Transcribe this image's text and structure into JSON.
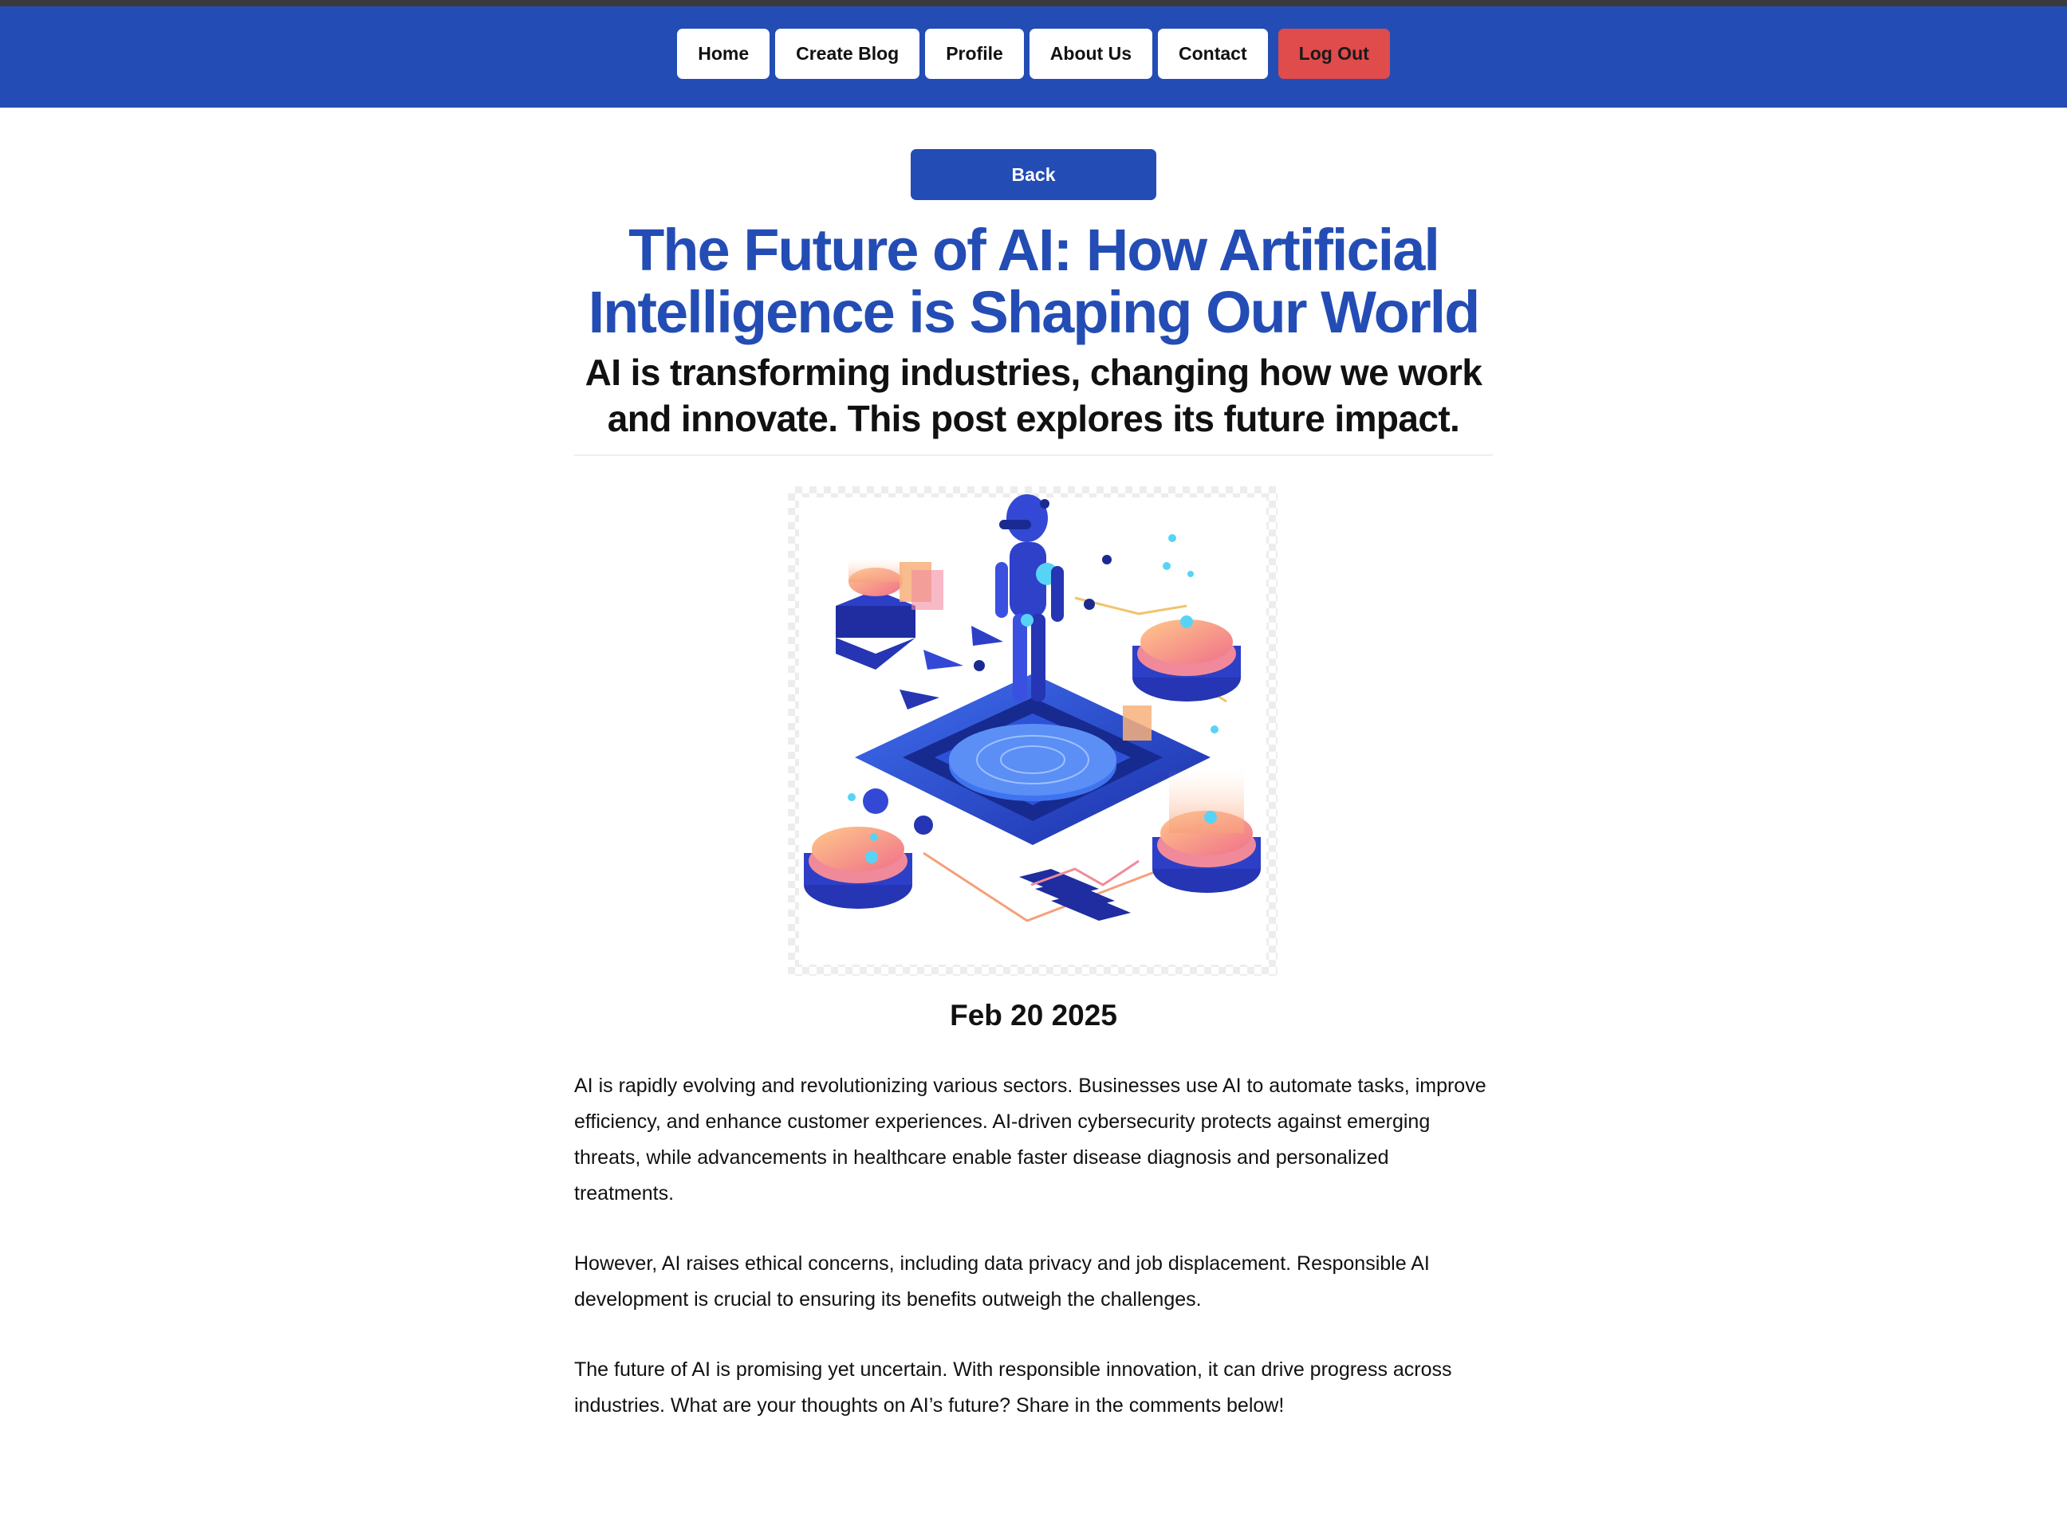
{
  "nav": {
    "items": [
      {
        "label": "Home",
        "name": "nav-home-button"
      },
      {
        "label": "Create Blog",
        "name": "nav-create-blog-button"
      },
      {
        "label": "Profile",
        "name": "nav-profile-button"
      },
      {
        "label": "About Us",
        "name": "nav-about-us-button"
      },
      {
        "label": "Contact",
        "name": "nav-contact-button"
      }
    ],
    "logout_label": "Log Out"
  },
  "post": {
    "back_label": "Back",
    "title": "The Future of AI: How Artificial Intelligence is Shaping Our World",
    "subtitle": "AI is transforming industries, changing how we work and innovate. This post explores its future impact.",
    "image_icon": "ai-isometric-illustration",
    "date": "Feb 20 2025",
    "paragraphs": [
      "AI is rapidly evolving and revolutionizing various sectors. Businesses use AI to automate tasks, improve efficiency, and enhance customer experiences. AI-driven cybersecurity protects against emerging threats, while advancements in healthcare enable faster disease diagnosis and personalized treatments.",
      "However, AI raises ethical concerns, including data privacy and job displacement. Responsible AI development is crucial to ensuring its benefits outweigh the challenges.",
      "The future of AI is promising yet uncertain. With responsible innovation, it can drive progress across industries. What are your thoughts on AI’s future? Share in the comments below!"
    ]
  },
  "colors": {
    "brand_blue": "#234db5",
    "logout_red": "#e04b4b",
    "background": "#ffffff"
  }
}
